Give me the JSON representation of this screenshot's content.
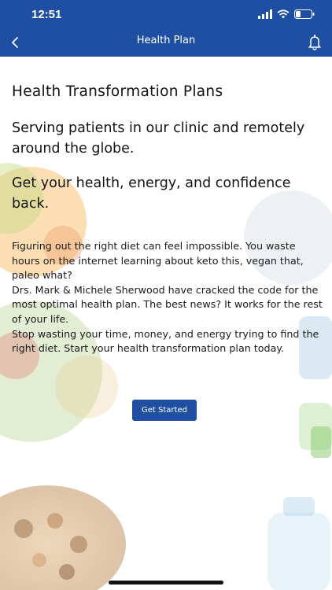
{
  "status": {
    "time": "12:51"
  },
  "nav": {
    "title": "Health Plan"
  },
  "content": {
    "heading": "Health Transformation Plans",
    "lead_1": "Serving patients in our clinic and remotely around the globe.",
    "lead_2": "Get your health, energy, and confidence back.",
    "paragraphs": [
      "Figuring out the right diet can feel impossible. You waste hours on the internet learning about keto this, vegan that, paleo what?",
      "Drs. Mark & Michele Sherwood have cracked the code for the most optimal health plan. The best news? It works for the rest of your life.",
      "Stop wasting your time, money, and energy trying to find the right diet. Start your health transformation plan today."
    ],
    "cta_label": "Get Started"
  },
  "colors": {
    "brand_blue": "#1e4fa3",
    "text": "#141414",
    "background": "#ffffff"
  }
}
